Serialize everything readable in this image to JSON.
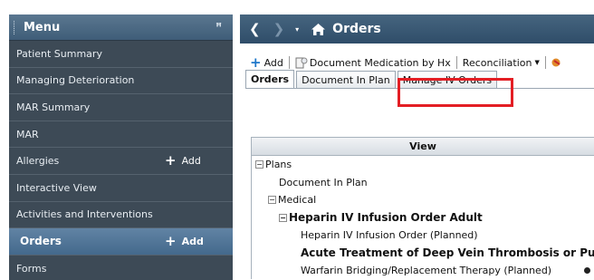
{
  "menu": {
    "title": "Menu",
    "pin_glyph": "ꟸ",
    "items": [
      {
        "label": "Patient Summary"
      },
      {
        "label": "Managing Deterioration"
      },
      {
        "label": "MAR Summary"
      },
      {
        "label": "MAR"
      },
      {
        "label": "Allergies",
        "add_label": "Add"
      },
      {
        "label": "Interactive View"
      },
      {
        "label": "Activities and Interventions"
      },
      {
        "label": "Orders",
        "add_label": "Add"
      },
      {
        "label": "Forms"
      }
    ]
  },
  "nav": {
    "back_glyph": "❮",
    "forward_glyph": "❯",
    "dropdown_glyph": "▾",
    "title": "Orders"
  },
  "toolbar": {
    "add_label": "Add",
    "document_med_label": "Document Medication by Hx",
    "reconciliation_label": "Reconciliation"
  },
  "tabs": [
    {
      "label": "Orders"
    },
    {
      "label": "Document In Plan"
    },
    {
      "label": "Manage IV Orders"
    }
  ],
  "grid": {
    "header": "View",
    "rows": [
      {
        "label": "Plans"
      },
      {
        "label": "Document In Plan"
      },
      {
        "label": "Medical"
      },
      {
        "label": "Heparin IV Infusion Order Adult"
      },
      {
        "label": "Heparin IV Infusion Order (Planned)"
      },
      {
        "label": "Acute Treatment of Deep Vein Thrombosis or Pu"
      },
      {
        "label": "Warfarin Bridging/Replacement Therapy (Planned)"
      }
    ]
  },
  "colors": {
    "menu_bg": "#3d4a56",
    "menu_active": "#44698c",
    "nav_bar": "#2f4d69",
    "highlight_box": "#e31e24",
    "toolbar_plus": "#1e77c9"
  }
}
